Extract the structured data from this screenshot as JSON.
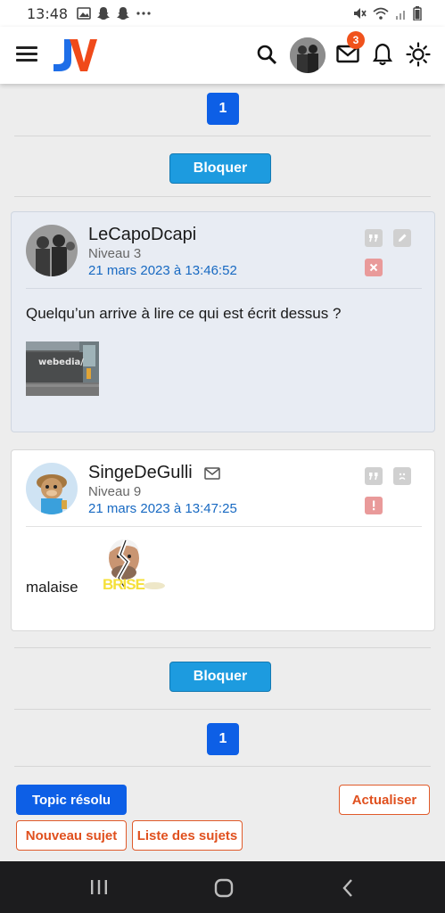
{
  "status_bar": {
    "time": "13:48",
    "icons_left": [
      "image-icon",
      "snapchat-icon",
      "snapchat-icon",
      "more-dots-icon"
    ],
    "icons_right": [
      "mute-icon",
      "wifi-icon",
      "signal-icon",
      "battery-icon"
    ]
  },
  "header": {
    "logo_text": "JV",
    "mail_badge": "3"
  },
  "pagination_top": {
    "page": "1"
  },
  "block_button_top": "Bloquer",
  "posts": [
    {
      "author": "LeCapoDcapi",
      "level": "Niveau 3",
      "date": "21 mars 2023 à 13:46:52",
      "message": "Quelqu’un arrive à lire ce qui est écrit dessus ?",
      "image_text": "webedia/"
    },
    {
      "author": "SingeDeGulli",
      "level": "Niveau 9",
      "date": "21 mars 2023 à 13:47:25",
      "message": "malaise",
      "sticker_text": "BRISE"
    }
  ],
  "block_button_bottom": "Bloquer",
  "pagination_bottom": {
    "page": "1"
  },
  "actions": {
    "resolved": "Topic résolu",
    "refresh": "Actualiser",
    "new_topic": "Nouveau sujet",
    "topic_list": "Liste des sujets"
  },
  "colors": {
    "primary_blue": "#0d5fe6",
    "block_blue": "#1d9bdf",
    "orange": "#e0501e",
    "link_blue": "#1769c2"
  }
}
